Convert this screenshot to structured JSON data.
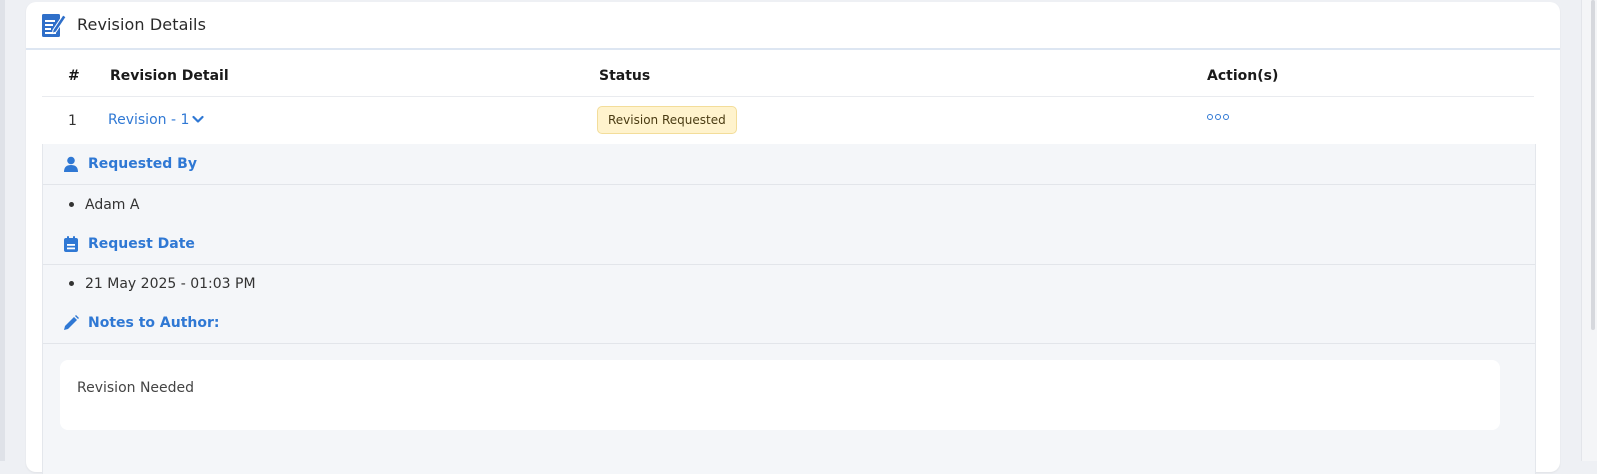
{
  "card": {
    "title": "Revision Details"
  },
  "table": {
    "headers": {
      "num": "#",
      "detail": "Revision Detail",
      "status": "Status",
      "actions": "Action(s)"
    },
    "rows": [
      {
        "num": "1",
        "revision": "Revision - 1",
        "status": "Revision Requested",
        "actions_icon": "more-dots-icon"
      }
    ]
  },
  "details": {
    "requested_by": {
      "label": "Requested By",
      "icon": "user-icon",
      "values": [
        "Adam A"
      ]
    },
    "request_date": {
      "label": "Request Date",
      "icon": "calendar-icon",
      "values": [
        "21 May 2025 - 01:03 PM"
      ]
    },
    "notes": {
      "label": "Notes to Author:",
      "icon": "pencil-icon",
      "text": "Revision Needed"
    }
  },
  "colors": {
    "accent": "#2f78d4",
    "badge_bg": "#fff3cd",
    "badge_border": "#f3dd9a",
    "details_bg": "#f4f6f9"
  }
}
